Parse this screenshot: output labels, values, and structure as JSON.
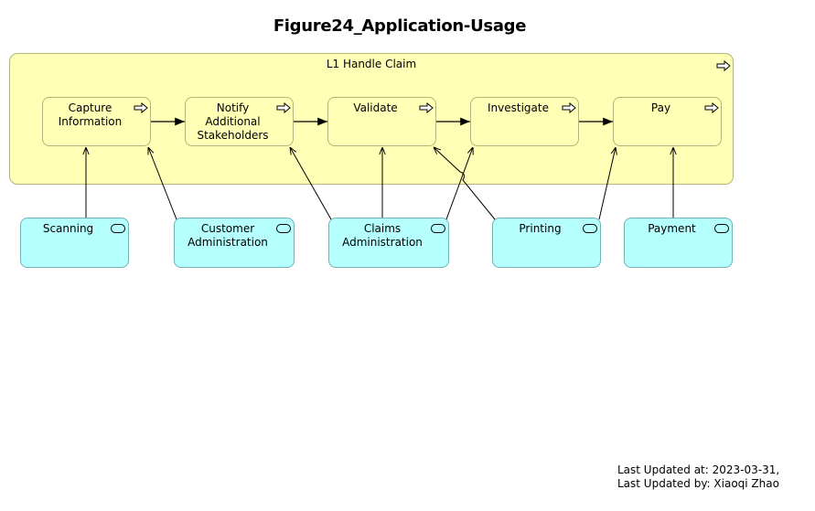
{
  "title": "Figure24_Application-Usage",
  "group": {
    "label": "L1 Handle Claim",
    "icon": "process-arrow-icon"
  },
  "processes": [
    {
      "id": "capture",
      "label": "Capture Information",
      "lines": [
        "Capture",
        "Information"
      ],
      "icon": "process-arrow-icon"
    },
    {
      "id": "notify",
      "label": "Notify Additional Stakeholders",
      "lines": [
        "Notify",
        "Additional",
        "Stakeholders"
      ],
      "icon": "process-arrow-icon"
    },
    {
      "id": "validate",
      "label": "Validate",
      "lines": [
        "Validate"
      ],
      "icon": "process-arrow-icon"
    },
    {
      "id": "investigate",
      "label": "Investigate",
      "lines": [
        "Investigate"
      ],
      "icon": "process-arrow-icon"
    },
    {
      "id": "pay",
      "label": "Pay",
      "lines": [
        "Pay"
      ],
      "icon": "process-arrow-icon"
    }
  ],
  "applications": [
    {
      "id": "scanning",
      "label": "Scanning",
      "lines": [
        "Scanning"
      ],
      "icon": "application-service-icon"
    },
    {
      "id": "customer-admin",
      "label": "Customer Administration",
      "lines": [
        "Customer",
        "Administration"
      ],
      "icon": "application-service-icon"
    },
    {
      "id": "claims-admin",
      "label": "Claims Administration",
      "lines": [
        "Claims",
        "Administration"
      ],
      "icon": "application-service-icon"
    },
    {
      "id": "printing",
      "label": "Printing",
      "lines": [
        "Printing"
      ],
      "icon": "application-service-icon"
    },
    {
      "id": "payment",
      "label": "Payment",
      "lines": [
        "Payment"
      ],
      "icon": "application-service-icon"
    }
  ],
  "triggers": [
    {
      "from": "capture",
      "to": "notify"
    },
    {
      "from": "notify",
      "to": "validate"
    },
    {
      "from": "validate",
      "to": "investigate"
    },
    {
      "from": "investigate",
      "to": "pay"
    }
  ],
  "serves": [
    {
      "from": "scanning",
      "to": "capture"
    },
    {
      "from": "customer-admin",
      "to": "capture"
    },
    {
      "from": "claims-admin",
      "to": "notify"
    },
    {
      "from": "claims-admin",
      "to": "validate"
    },
    {
      "from": "claims-admin",
      "to": "investigate"
    },
    {
      "from": "printing",
      "to": "validate"
    },
    {
      "from": "printing",
      "to": "pay"
    },
    {
      "from": "payment",
      "to": "pay"
    }
  ],
  "colors": {
    "process_fill": "#ffffb5",
    "application_fill": "#b5ffff"
  },
  "footer": {
    "updated_at": "Last Updated at: 2023-03-31,",
    "updated_by": "Last Updated by: Xiaoqi Zhao"
  }
}
